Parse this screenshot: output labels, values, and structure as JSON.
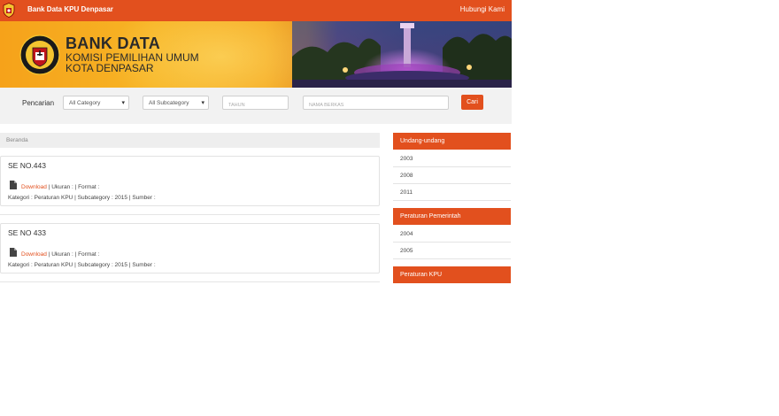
{
  "topbar": {
    "brand": "Bank Data KPU Denpasar",
    "contact": "Hubungi Kami"
  },
  "banner": {
    "title": "BANK DATA",
    "line2": "KOMISI PEMILIHAN UMUM",
    "line3": "KOTA DENPASAR"
  },
  "search": {
    "label": "Pencarian",
    "category": "All Category",
    "subcategory": "All Subcategory",
    "year_placeholder": "TAHUN",
    "name_placeholder": "NAMA BERKAS",
    "button": "Cari"
  },
  "breadcrumb": "Beranda",
  "documents": [
    {
      "title": "SE NO.443",
      "download": "Download",
      "details": " | Ukuran : | Format :",
      "meta": "Kategori : Peraturan KPU | Subcategory : 2015 | Sumber :"
    },
    {
      "title": "SE NO 433",
      "download": "Download",
      "details": " | Ukuran : | Format :",
      "meta": "Kategori : Peraturan KPU | Subcategory : 2015 | Sumber :"
    }
  ],
  "sidebar": {
    "panels": [
      {
        "title": "Undang-undang",
        "items": [
          "2003",
          "2008",
          "2011"
        ]
      },
      {
        "title": "Peraturan Pemerintah",
        "items": [
          "2004",
          "2005"
        ]
      },
      {
        "title": "Peraturan KPU",
        "items": []
      }
    ]
  },
  "colors": {
    "accent": "#e2501e",
    "banner_gold": "#f6a21a",
    "panel_bg": "#f2f2f2"
  }
}
